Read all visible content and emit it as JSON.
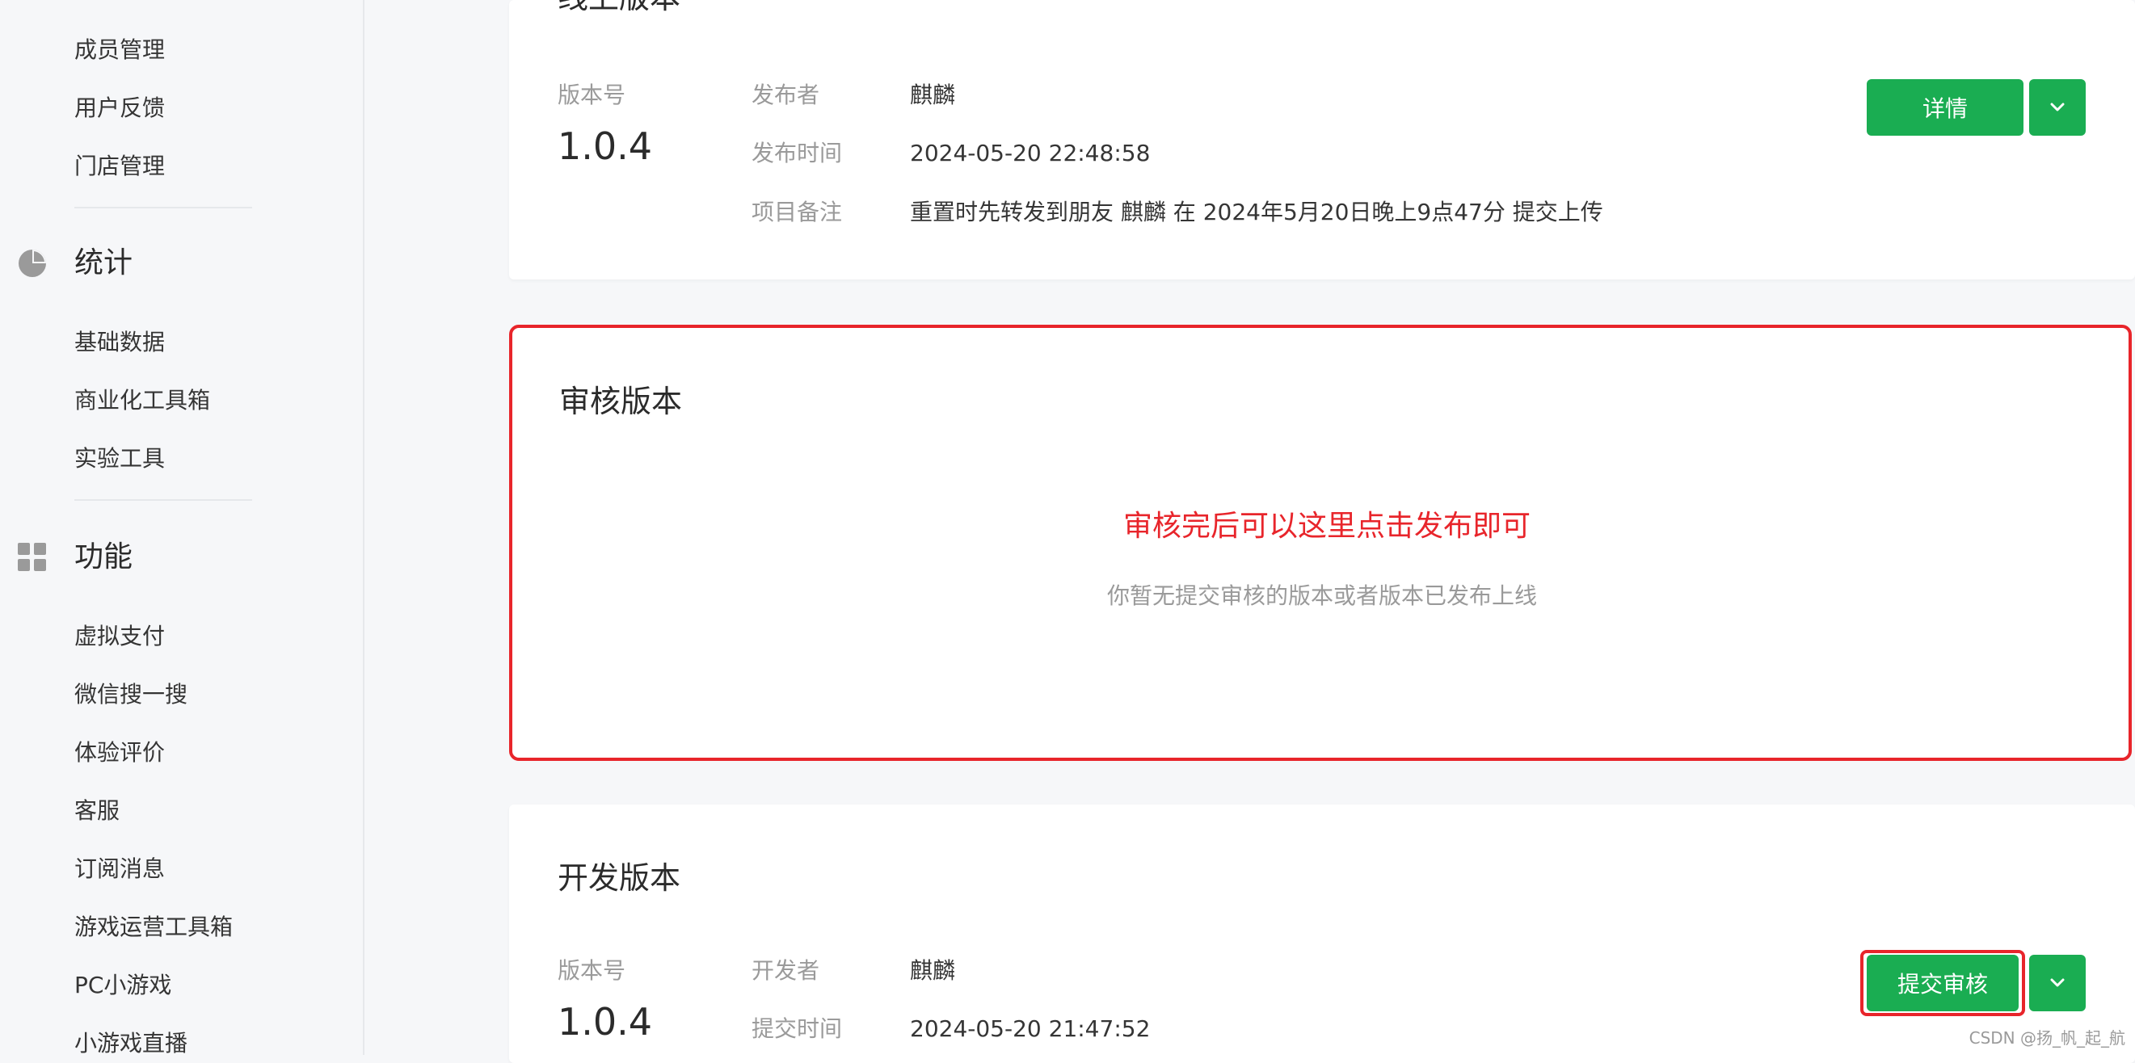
{
  "sidebar": {
    "items_top": [
      "成员管理",
      "用户反馈",
      "门店管理"
    ],
    "stats": {
      "title": "统计",
      "icon": "pie-chart-icon",
      "items": [
        "基础数据",
        "商业化工具箱",
        "实验工具"
      ]
    },
    "features": {
      "title": "功能",
      "icon": "grid-icon",
      "items": [
        "虚拟支付",
        "微信搜一搜",
        "体验评价",
        "客服",
        "订阅消息",
        "游戏运营工具箱",
        "PC小游戏",
        "小游戏直播"
      ]
    }
  },
  "online": {
    "title": "线上版本",
    "version_label": "版本号",
    "version": "1.0.4",
    "fields": [
      {
        "label": "发布者",
        "value": "麒麟"
      },
      {
        "label": "发布时间",
        "value": "2024-05-20 22:48:58"
      },
      {
        "label": "项目备注",
        "value": "重置时先转发到朋友 麒麟 在 2024年5月20日晚上9点47分 提交上传"
      }
    ],
    "detail_button": "详情"
  },
  "review": {
    "title": "审核版本",
    "annotation": "审核完后可以这里点击发布即可",
    "empty_text": "你暂无提交审核的版本或者版本已发布上线"
  },
  "dev": {
    "title": "开发版本",
    "version_label": "版本号",
    "version": "1.0.4",
    "fields": [
      {
        "label": "开发者",
        "value": "麒麟"
      },
      {
        "label": "提交时间",
        "value": "2024-05-20 21:47:52"
      }
    ],
    "submit_button": "提交审核"
  },
  "watermark": "CSDN @扬_帆_起_航",
  "colors": {
    "primary_green": "#1aad52",
    "annotation_red": "#e8252b"
  }
}
